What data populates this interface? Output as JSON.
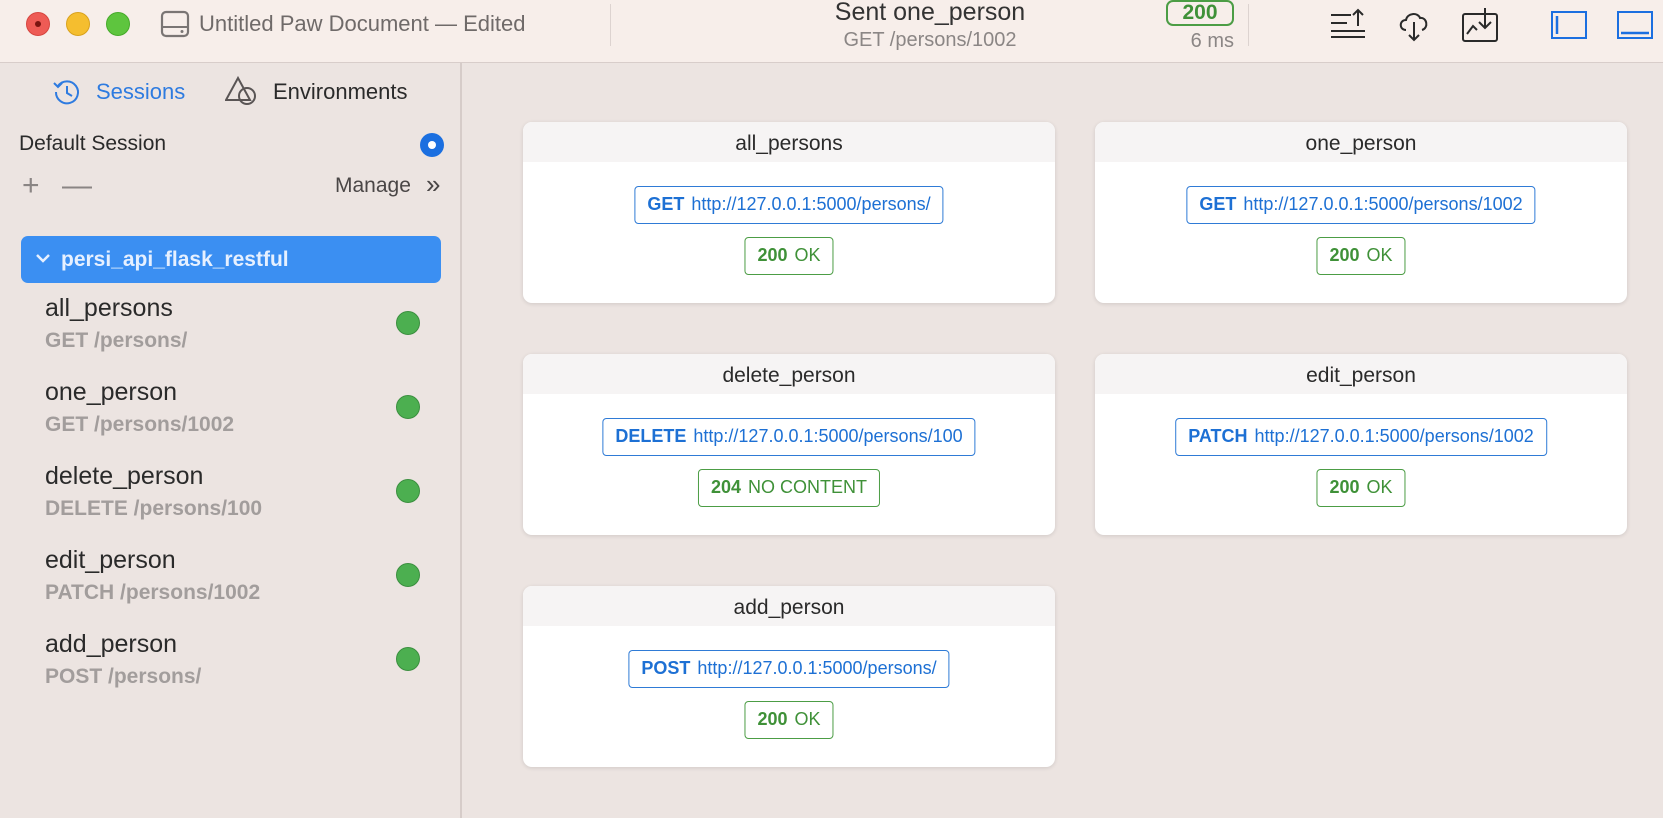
{
  "window": {
    "document_title": "Untitled Paw Document",
    "document_state": "— Edited",
    "sent_prefix": "Sent",
    "sent_request": "one_person",
    "sent_path": "GET /persons/1002",
    "status_code": "200",
    "elapsed": "6 ms"
  },
  "sidebar": {
    "tabs": {
      "sessions": "Sessions",
      "environments": "Environments"
    },
    "session_name": "Default Session",
    "manage_label": "Manage",
    "manage_chevron": "»",
    "add_label": "+",
    "remove_label": "—",
    "group_name": "persi_api_flask_restful",
    "items": [
      {
        "name": "all_persons",
        "path": "GET /persons/"
      },
      {
        "name": "one_person",
        "path": "GET /persons/1002"
      },
      {
        "name": "delete_person",
        "path": "DELETE /persons/100"
      },
      {
        "name": "edit_person",
        "path": "PATCH /persons/1002"
      },
      {
        "name": "add_person",
        "path": "POST /persons/"
      }
    ]
  },
  "cards": [
    {
      "title": "all_persons",
      "method": "GET",
      "url": "http://127.0.0.1:5000/persons/",
      "code": "200",
      "status": "OK"
    },
    {
      "title": "one_person",
      "method": "GET",
      "url": "http://127.0.0.1:5000/persons/1002",
      "code": "200",
      "status": "OK"
    },
    {
      "title": "delete_person",
      "method": "DELETE",
      "url": "http://127.0.0.1:5000/persons/100",
      "code": "204",
      "status": "NO CONTENT"
    },
    {
      "title": "edit_person",
      "method": "PATCH",
      "url": "http://127.0.0.1:5000/persons/1002",
      "code": "200",
      "status": "OK"
    },
    {
      "title": "add_person",
      "method": "POST",
      "url": "http://127.0.0.1:5000/persons/",
      "code": "200",
      "status": "OK"
    }
  ],
  "colors": {
    "accent": "#2e7be0",
    "selection": "#3b8ff2",
    "success": "#3f9138",
    "status_dot": "#4caf50"
  },
  "icons": {
    "titlebar": [
      "disk-icon",
      "export-icon",
      "cloud-sync-icon",
      "import-icon",
      "toggle-sidebar-icon",
      "toggle-bottom-panel-icon"
    ],
    "sidebar": [
      "history-clock-icon",
      "environments-shapes-icon",
      "chevron-down-icon"
    ]
  }
}
